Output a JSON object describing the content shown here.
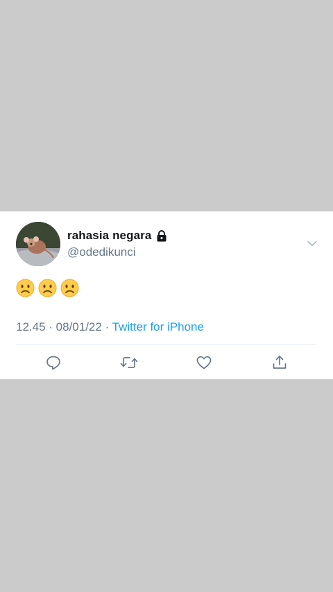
{
  "tweet": {
    "display_name": "rahasia negara",
    "handle": "@odedikunci",
    "text_emojis": [
      "frowning-face",
      "frowning-face",
      "frowning-face"
    ],
    "time": "12.45",
    "separator1": " · ",
    "date": "08/01/22",
    "separator2": " · ",
    "source": "Twitter for iPhone"
  },
  "icons": {
    "lock": "lock-icon",
    "menu": "chevron-down-icon",
    "reply": "reply-icon",
    "retweet": "retweet-icon",
    "like": "heart-icon",
    "share": "share-icon"
  },
  "colors": {
    "background": "#cbcbcb",
    "card": "#ffffff",
    "text_primary": "#14171a",
    "text_secondary": "#657786",
    "link": "#1da1f2",
    "emoji": "#ffcc4d"
  }
}
